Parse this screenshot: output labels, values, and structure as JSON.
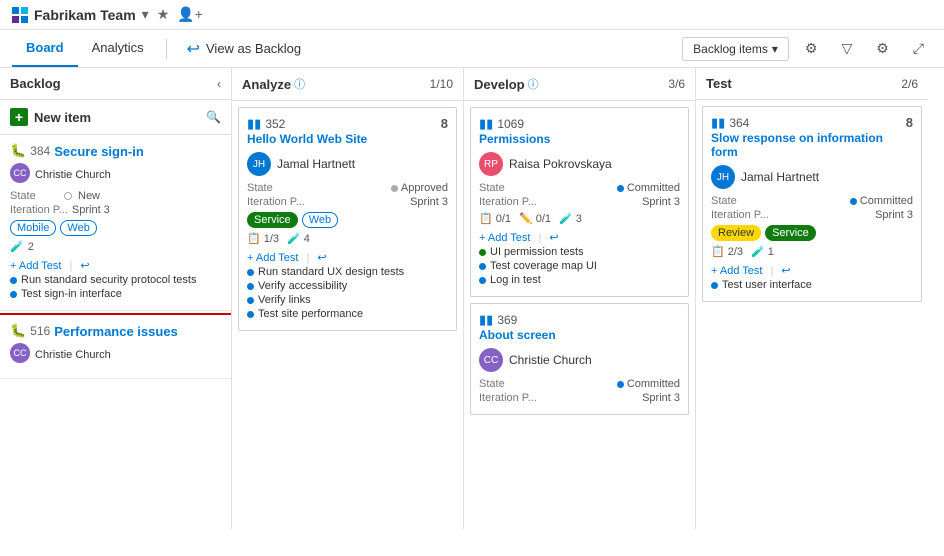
{
  "header": {
    "team_name": "Fabrikam Team",
    "logo_alt": "Fabrikam logo"
  },
  "nav": {
    "items": [
      {
        "label": "Board",
        "active": true
      },
      {
        "label": "Analytics",
        "active": false
      }
    ],
    "view_as": "View as Backlog",
    "backlog_items_label": "Backlog items",
    "dropdown_icon": "▾"
  },
  "backlog": {
    "title": "Backlog",
    "new_item_label": "New item",
    "cards": [
      {
        "id": "384",
        "title": "Secure sign-in",
        "assignee": "Christie Church",
        "avatar_initials": "CC",
        "avatar_class": "avatar-cc",
        "state": "New",
        "iteration": "Sprint 3",
        "tags": [
          "Mobile",
          "Web"
        ],
        "flask_count": 2
      },
      {
        "id": "516",
        "title": "Performance issues",
        "assignee": "Christie Church",
        "avatar_initials": "CC",
        "avatar_class": "avatar-cc",
        "state": "",
        "iteration": "",
        "tags": [],
        "flask_count": 0
      }
    ]
  },
  "columns": [
    {
      "id": "analyze",
      "title": "Analyze",
      "count": "1",
      "total": "10",
      "cards": [
        {
          "id": "352",
          "title": "Hello World Web Site",
          "assignee": "Jamal Hartnett",
          "avatar_initials": "JH",
          "avatar_class": "avatar-jh",
          "avatar_bg": "#0078d4",
          "right_num": "8",
          "state": "Approved",
          "state_dot": "dot-gray",
          "iteration": "Sprint 3",
          "tags": [
            "Service",
            "Web"
          ],
          "fractions": [
            {
              "icon": "📋",
              "value": "1/3",
              "type": "pass"
            },
            {
              "icon": "🧪",
              "value": "4",
              "type": "flask"
            }
          ],
          "actions": [
            "+ Add Test",
            "↩"
          ],
          "test_items": [
            "Run standard UX design tests",
            "Verify accessibility",
            "Verify links",
            "Test site performance"
          ]
        }
      ]
    },
    {
      "id": "develop",
      "title": "Develop",
      "count": "3",
      "total": "6",
      "cards": [
        {
          "id": "1069",
          "title": "Permissions",
          "assignee": "Raisa Pokrovskaya",
          "avatar_initials": "RP",
          "avatar_class": "avatar-rp",
          "avatar_bg": "#e84f6c",
          "right_num": "",
          "state": "Committed",
          "state_dot": "dot-blue",
          "iteration": "Sprint 3",
          "tags": [],
          "fractions": [
            {
              "icon": "📋",
              "value": "0/1",
              "type": "pass"
            },
            {
              "icon": "✏️",
              "value": "0/1",
              "type": "pencil"
            },
            {
              "icon": "🧪",
              "value": "3",
              "type": "flask"
            }
          ],
          "actions": [
            "+ Add Test",
            "↩"
          ],
          "test_items": [
            "UI permission tests",
            "Test coverage map UI",
            "Log in test"
          ]
        },
        {
          "id": "369",
          "title": "About screen",
          "assignee": "Christie Church",
          "avatar_initials": "CC",
          "avatar_class": "avatar-cc",
          "avatar_bg": "#8661c5",
          "right_num": "",
          "state": "Committed",
          "state_dot": "dot-blue",
          "iteration": "Sprint 3",
          "tags": [],
          "fractions": [],
          "actions": [],
          "test_items": []
        }
      ]
    },
    {
      "id": "test",
      "title": "Test",
      "count": "2",
      "total": "6",
      "cards": [
        {
          "id": "364",
          "title": "Slow response on information form",
          "assignee": "Jamal Hartnett",
          "avatar_initials": "JH",
          "avatar_class": "avatar-jh",
          "avatar_bg": "#0078d4",
          "right_num": "8",
          "state": "Committed",
          "state_dot": "dot-blue",
          "iteration": "Sprint 3",
          "tags": [
            "Review",
            "Service"
          ],
          "fractions": [
            {
              "icon": "📋",
              "value": "2/3",
              "type": "pass"
            },
            {
              "icon": "🧪",
              "value": "1",
              "type": "flask"
            }
          ],
          "actions": [
            "+ Add Test",
            "↩"
          ],
          "test_items": [
            "Test user interface"
          ]
        }
      ]
    }
  ],
  "backlog_card1": {
    "test_items": [
      "Run standard security protocol tests",
      "Test sign-in interface"
    ]
  }
}
